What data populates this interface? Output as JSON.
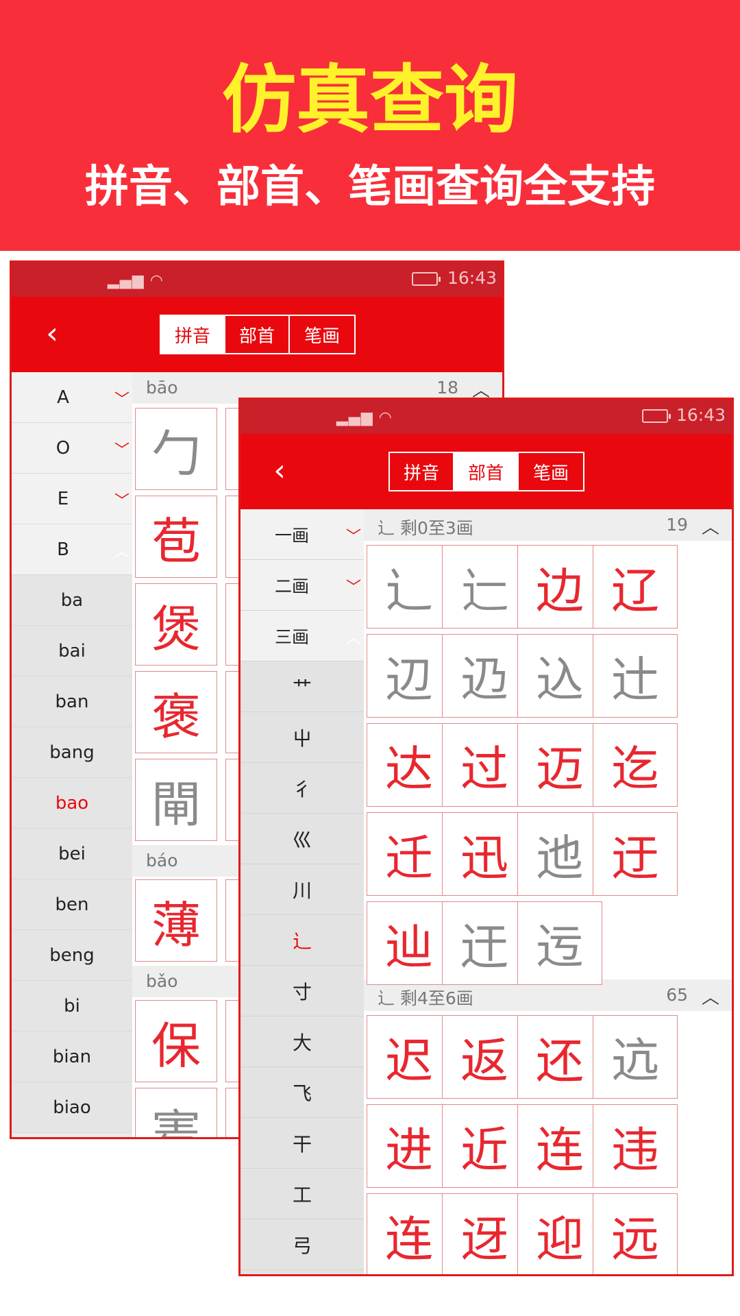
{
  "banner": {
    "title": "仿真查询",
    "subtitle": "拼音、部首、笔画查询全支持"
  },
  "colors": {
    "banner_bg": "#f82f3a",
    "title": "#fff22b",
    "toolbar": "#e8080e",
    "char_red": "#e8272f",
    "char_gray": "#8a8a8a"
  },
  "back_phone": {
    "status": {
      "signal_icon": "signal-wifi-icon",
      "time": "16:43"
    },
    "tabs": [
      "拼音",
      "部首",
      "笔画"
    ],
    "active_tab": "拼音",
    "letters": [
      {
        "label": "A",
        "chevron": "﹀"
      },
      {
        "label": "O",
        "chevron": "﹀"
      },
      {
        "label": "E",
        "chevron": "﹀"
      },
      {
        "label": "B",
        "chevron": "︿"
      }
    ],
    "syllables": [
      "ba",
      "bai",
      "ban",
      "bang",
      "bao",
      "bei",
      "ben",
      "beng",
      "bi",
      "bian",
      "biao"
    ],
    "selected_syllable": "bao",
    "sections": [
      {
        "label": "bāo",
        "count": "18",
        "chars": [
          {
            "c": "勹",
            "color": "gray"
          },
          {
            "c": "苞",
            "color": "red"
          },
          {
            "c": "煲",
            "color": "red"
          },
          {
            "c": "褒",
            "color": "red"
          },
          {
            "c": "閘",
            "color": "gray"
          }
        ]
      },
      {
        "label": "báo",
        "chars": [
          {
            "c": "薄",
            "color": "red"
          }
        ]
      },
      {
        "label": "bǎo",
        "chars": [
          {
            "c": "保",
            "color": "red"
          },
          {
            "c": "寚",
            "color": "gray"
          }
        ]
      }
    ]
  },
  "front_phone": {
    "status": {
      "time": "16:43"
    },
    "tabs": [
      "拼音",
      "部首",
      "笔画"
    ],
    "active_tab": "部首",
    "strokes": [
      {
        "label": "一画",
        "chevron": "﹀"
      },
      {
        "label": "二画",
        "chevron": "﹀"
      },
      {
        "label": "三画",
        "chevron": "︿"
      }
    ],
    "radicals": [
      "艹",
      "屮",
      "彳",
      "巛",
      "川",
      "辶",
      "寸",
      "大",
      "飞",
      "干",
      "工",
      "弓"
    ],
    "selected_radical": "辶",
    "sections": [
      {
        "label": "辶 剩0至3画",
        "count": "19",
        "chars": [
          {
            "c": "辶",
            "color": "gray"
          },
          {
            "c": "辷",
            "color": "gray"
          },
          {
            "c": "边",
            "color": "red"
          },
          {
            "c": "辽",
            "color": "red"
          },
          {
            "c": "辺",
            "color": "gray"
          },
          {
            "c": "辸",
            "color": "gray"
          },
          {
            "c": "込",
            "color": "gray"
          },
          {
            "c": "辻",
            "color": "gray"
          },
          {
            "c": "达",
            "color": "red"
          },
          {
            "c": "过",
            "color": "red"
          },
          {
            "c": "迈",
            "color": "red"
          },
          {
            "c": "迄",
            "color": "red"
          },
          {
            "c": "迁",
            "color": "red"
          },
          {
            "c": "迅",
            "color": "red"
          },
          {
            "c": "迆",
            "color": "gray"
          },
          {
            "c": "迂",
            "color": "red"
          },
          {
            "c": "辿",
            "color": "red"
          },
          {
            "c": "迀",
            "color": "gray"
          },
          {
            "c": "迃",
            "color": "gray"
          }
        ]
      },
      {
        "label": "辶 剩4至6画",
        "count": "65",
        "chars": [
          {
            "c": "迟",
            "color": "red"
          },
          {
            "c": "返",
            "color": "red"
          },
          {
            "c": "还",
            "color": "red"
          },
          {
            "c": "迒",
            "color": "gray"
          },
          {
            "c": "进",
            "color": "red"
          },
          {
            "c": "近",
            "color": "red"
          },
          {
            "c": "连",
            "color": "red"
          },
          {
            "c": "违",
            "color": "red"
          },
          {
            "c": "连",
            "color": "red"
          },
          {
            "c": "迓",
            "color": "red"
          },
          {
            "c": "迎",
            "color": "red"
          },
          {
            "c": "远",
            "color": "red"
          }
        ]
      }
    ],
    "collapse_arrow": "︿"
  }
}
